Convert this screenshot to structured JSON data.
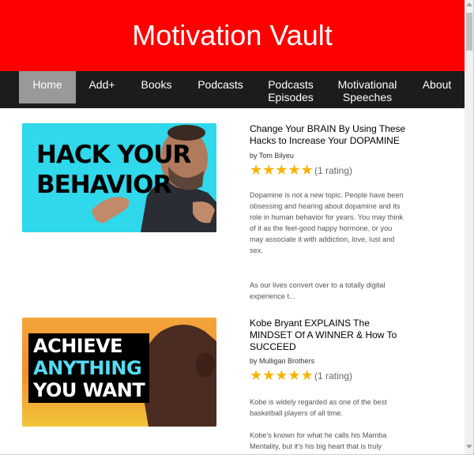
{
  "site": {
    "title": "Motivation Vault"
  },
  "nav": {
    "items": [
      {
        "label": "Home",
        "active": true
      },
      {
        "label": "Add+"
      },
      {
        "label": "Books"
      },
      {
        "label": "Podcasts"
      },
      {
        "label": "Podcasts Episodes"
      },
      {
        "label": "Motivational Speeches"
      },
      {
        "label": "About"
      }
    ]
  },
  "colors": {
    "header": "#ff0000",
    "nav": "#1c1c1c",
    "active_tab": "#999999",
    "star": "#f5b400"
  },
  "items": [
    {
      "thumbnail_text": [
        "HACK YOUR",
        "BEHAVIOR"
      ],
      "title": "Change Your BRAIN By Using These Hacks to Increase Your DOPAMINE",
      "author_prefix": "by",
      "author": "Tom Bilyeu",
      "stars": "★★★★★",
      "rating": "(1 rating)",
      "description_1": "Dopamine is not a new topic. People have been obsessing and hearing about dopamine and its role in human behavior for years. You may think of it as the feel-good happy hormone, or you may associate it with addiction, love, lust and sex.",
      "description_2": "As our lives convert over to a totally digital experience t..."
    },
    {
      "thumbnail_text": [
        "ACHIEVE",
        "ANYTHING",
        "YOU WANT"
      ],
      "title": "Kobe Bryant EXPLAINS The MINDSET Of A WINNER & How To SUCCEED",
      "author_prefix": "by",
      "author": "Mulligan Brothers",
      "stars": "★★★★★",
      "rating": "(1 rating)",
      "description_1": "Kobe is widely regarded as one of the best basketball players of all time.",
      "description_2": "Kobe's known for what he calls his Mamba Mentality, but it's his big heart that is truly"
    }
  ]
}
